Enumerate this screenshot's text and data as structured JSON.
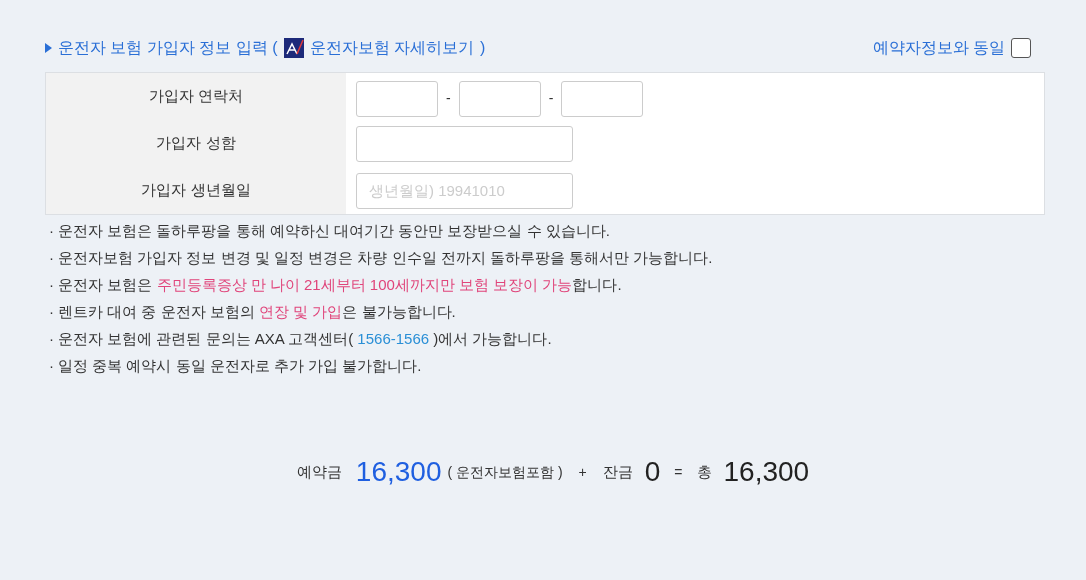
{
  "header": {
    "title": "운전자 보험 가입자 정보 입력 (",
    "link": "운전자보험 자세히보기",
    "close": ")",
    "same_label": "예약자정보와 동일",
    "same_checked": false
  },
  "form": {
    "rows": [
      {
        "label": "가입자 연락처",
        "kind": "phone",
        "parts": [
          "-",
          "-"
        ]
      },
      {
        "label": "가입자 성함",
        "kind": "text"
      },
      {
        "label": "가입자 생년월일",
        "kind": "text",
        "placeholder": "생년월일) 19941010"
      }
    ]
  },
  "notes": [
    [
      {
        "text": "· 운전자 보험은 돌하루팡을 통해 예약하신 대여기간 동안만 보장받으실 수 있습니다.",
        "kind": "plain"
      }
    ],
    [
      {
        "text": "· 운전자보험 가입자 정보 변경 및 일정 변경은 차량 인수일 전까지 돌하루팡을 통해서만 가능합니다.",
        "kind": "plain"
      }
    ],
    [
      {
        "text": "· 운전자 보험은 ",
        "kind": "plain"
      },
      {
        "text": "주민등록증상 만 나이 21세부터 100세까지만 보험 보장이 가능",
        "kind": "warn"
      },
      {
        "text": "합니다.",
        "kind": "plain"
      }
    ],
    [
      {
        "text": "· 렌트카 대여 중 운전자 보험의 ",
        "kind": "plain"
      },
      {
        "text": "연장 및 가입",
        "kind": "warn"
      },
      {
        "text": "은 불가능합니다.",
        "kind": "plain"
      }
    ],
    [
      {
        "text": "· 운전자 보험에 관련된 문의는 AXA 고객센터( ",
        "kind": "plain"
      },
      {
        "text": "1566-1566",
        "kind": "info"
      },
      {
        "text": " )에서 가능합니다.",
        "kind": "plain"
      }
    ],
    [
      {
        "text": "· 일정 중복 예약시 동일 운전자로 추가 가입 불가합니다.",
        "kind": "plain"
      }
    ]
  ],
  "summary": {
    "deposit_label": "예약금",
    "deposit": "16,300",
    "deposit_note": "( 운전자보험포함 )",
    "plus": "+",
    "balance_label": "잔금",
    "balance": "0",
    "equals": "=",
    "total_label": "총",
    "total": "16,300"
  }
}
